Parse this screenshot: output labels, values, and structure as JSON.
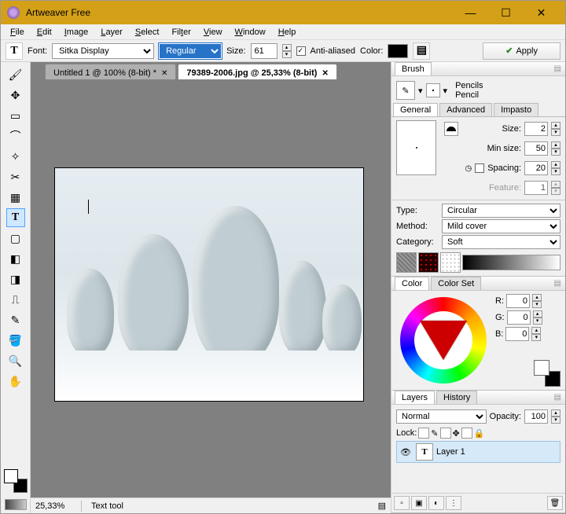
{
  "window": {
    "title": "Artweaver Free"
  },
  "menu": [
    "File",
    "Edit",
    "Image",
    "Layer",
    "Select",
    "Filter",
    "View",
    "Window",
    "Help"
  ],
  "font_toolbar": {
    "label_font": "Font:",
    "font_family": "Sitka Display",
    "style": "Regular",
    "label_size": "Size:",
    "size": "61",
    "anti": "Anti-aliased",
    "label_color": "Color:",
    "apply": "Apply"
  },
  "tabs": [
    {
      "label": "Untitled 1 @ 100% (8-bit) *",
      "active": false
    },
    {
      "label": "79389-2006.jpg @ 25,33% (8-bit)",
      "active": true
    }
  ],
  "status": {
    "zoom": "25,33%",
    "tool": "Text tool"
  },
  "brush_panel": {
    "title": "Brush",
    "category_name": "Pencils",
    "brush_name": "Pencil",
    "subtabs": [
      "General",
      "Advanced",
      "Impasto"
    ],
    "size_lbl": "Size:",
    "size": "2",
    "minsize_lbl": "Min size:",
    "minsize": "50",
    "spacing_lbl": "Spacing:",
    "spacing": "20",
    "feature_lbl": "Feature:",
    "feature": "1",
    "type_lbl": "Type:",
    "type": "Circular",
    "method_lbl": "Method:",
    "method": "Mild cover",
    "category_lbl": "Category:",
    "category": "Soft"
  },
  "color_panel": {
    "title": "Color",
    "alt_tab": "Color Set",
    "r_lbl": "R:",
    "r": "0",
    "g_lbl": "G:",
    "g": "0",
    "b_lbl": "B:",
    "b": "0"
  },
  "layers_panel": {
    "title": "Layers",
    "alt_tab": "History",
    "blend": "Normal",
    "opacity_lbl": "Opacity:",
    "opacity": "100",
    "lock_lbl": "Lock:",
    "layer_name": "Layer 1"
  }
}
